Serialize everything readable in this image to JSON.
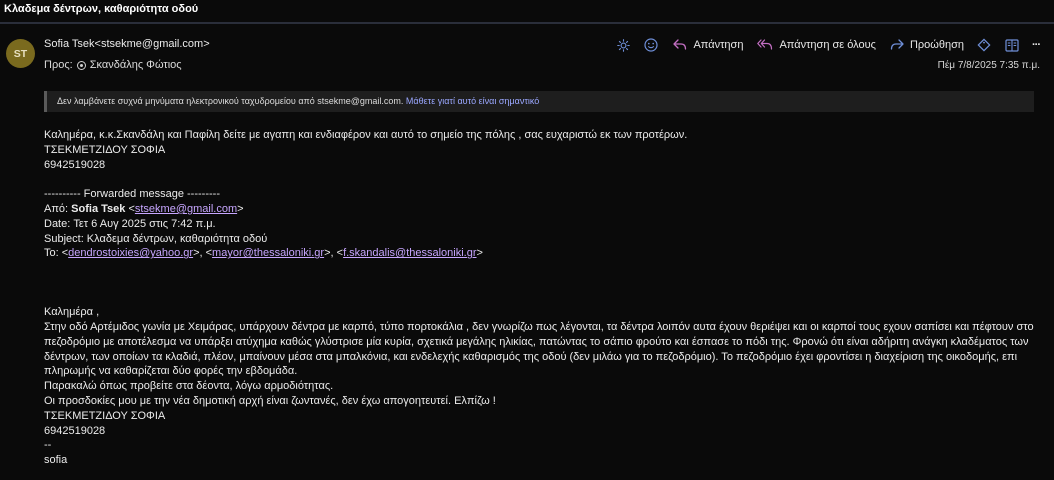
{
  "window": {
    "title": "Κλαδεμα δέντρων, καθαριότητα οδού"
  },
  "sender": {
    "initials": "ST",
    "display": "Sofia Tsek<stsekme@gmail.com>"
  },
  "recipient": {
    "prefix": "Προς:",
    "name": "Σκανδάλης Φώτιος"
  },
  "toolbar": {
    "reply_label": "Απάντηση",
    "reply_all_label": "Απάντηση σε όλους",
    "forward_label": "Προώθηση",
    "more_label": "···"
  },
  "date": "Πέμ 7/8/2025 7:35 π.μ.",
  "notice": {
    "text": "Δεν λαμβάνετε συχνά μηνύματα ηλεκτρονικού ταχυδρομείου από stsekme@gmail.com.",
    "link": "Μάθετε γιατί αυτό είναι σημαντικό"
  },
  "message": {
    "intro": "Καλημέρα, κ.κ.Σκανδάλη και Παφίλη δείτε με αγαπη και ενδιαφέρον και αυτό το σημείο της πόλης , σας ευχαριστώ εκ των προτέρων.",
    "signature_name": "ΤΣΕΚΜΕΤΖΙΔΟΥ ΣΟΦΙΑ",
    "signature_phone": "6942519028",
    "forward_header": "---------- Forwarded message ---------",
    "from_label": "Από:",
    "from_name": "Sofia Tsek",
    "from_email": "stsekme@gmail.com",
    "date_line": "Date: Τετ 6 Αυγ 2025 στις 7:42 π.μ.",
    "subject_line": "Subject: Κλαδεμα δέντρων, καθαριότητα οδού",
    "to_label": "To:",
    "to_emails": [
      "dendrostoixies@yahoo.gr",
      "mayor@thessaloniki.gr",
      "f.skandalis@thessaloniki.gr"
    ],
    "greeting": "Καλημέρα ,",
    "paragraph": "Στην οδό Αρτέμιδος γωνία με Χειμάρας, υπάρχουν δέντρα με καρπό, τύπο πορτοκάλια , δεν γνωρίζω πως λέγονται, τα δέντρα λοιπόν αυτα έχουν θεριέψει και οι καρποί τους εχουν σαπίσει και πέφτουν στο πεζοδρόμιο με αποτέλεσμα να υπάρξει ατύχημα καθώς γλύστρισε μία κυρία, σχετικά μεγάλης ηλικίας, πατώντας το σάπιο φρούτο και έσπασε το πόδι της. Φρονώ ότι είναι αδήριτη ανάγκη κλαδέματος των δέντρων, των οποίων τα κλαδιά, πλέον, μπαίνουν μέσα στα μπαλκόνια,  και ενδελεχής καθαρισμός της οδού (δεν μιλάω για το πεζοδρόμιο). Το πεζοδρόμιο έχει φροντίσει η διαχείριση της οικοδομής, επι πληρωμής να καθαρίζεται δύο φορές την εβδομάδα.",
    "request": "Παρακαλώ όπως προβείτε  στα δέοντα, λόγω αρμοδιότητας.",
    "expectations": "Οι προσδοκίες μου με την νέα δημοτική αρχή είναι ζωντανές, δεν έχω απογοητευτεί. Ελπίζω !",
    "sig_separator": "--",
    "sig_short": "sofia"
  },
  "colors": {
    "accent": "#6f8fd8",
    "link": "#c7a6ff",
    "notice_link": "#9aa7ff"
  }
}
